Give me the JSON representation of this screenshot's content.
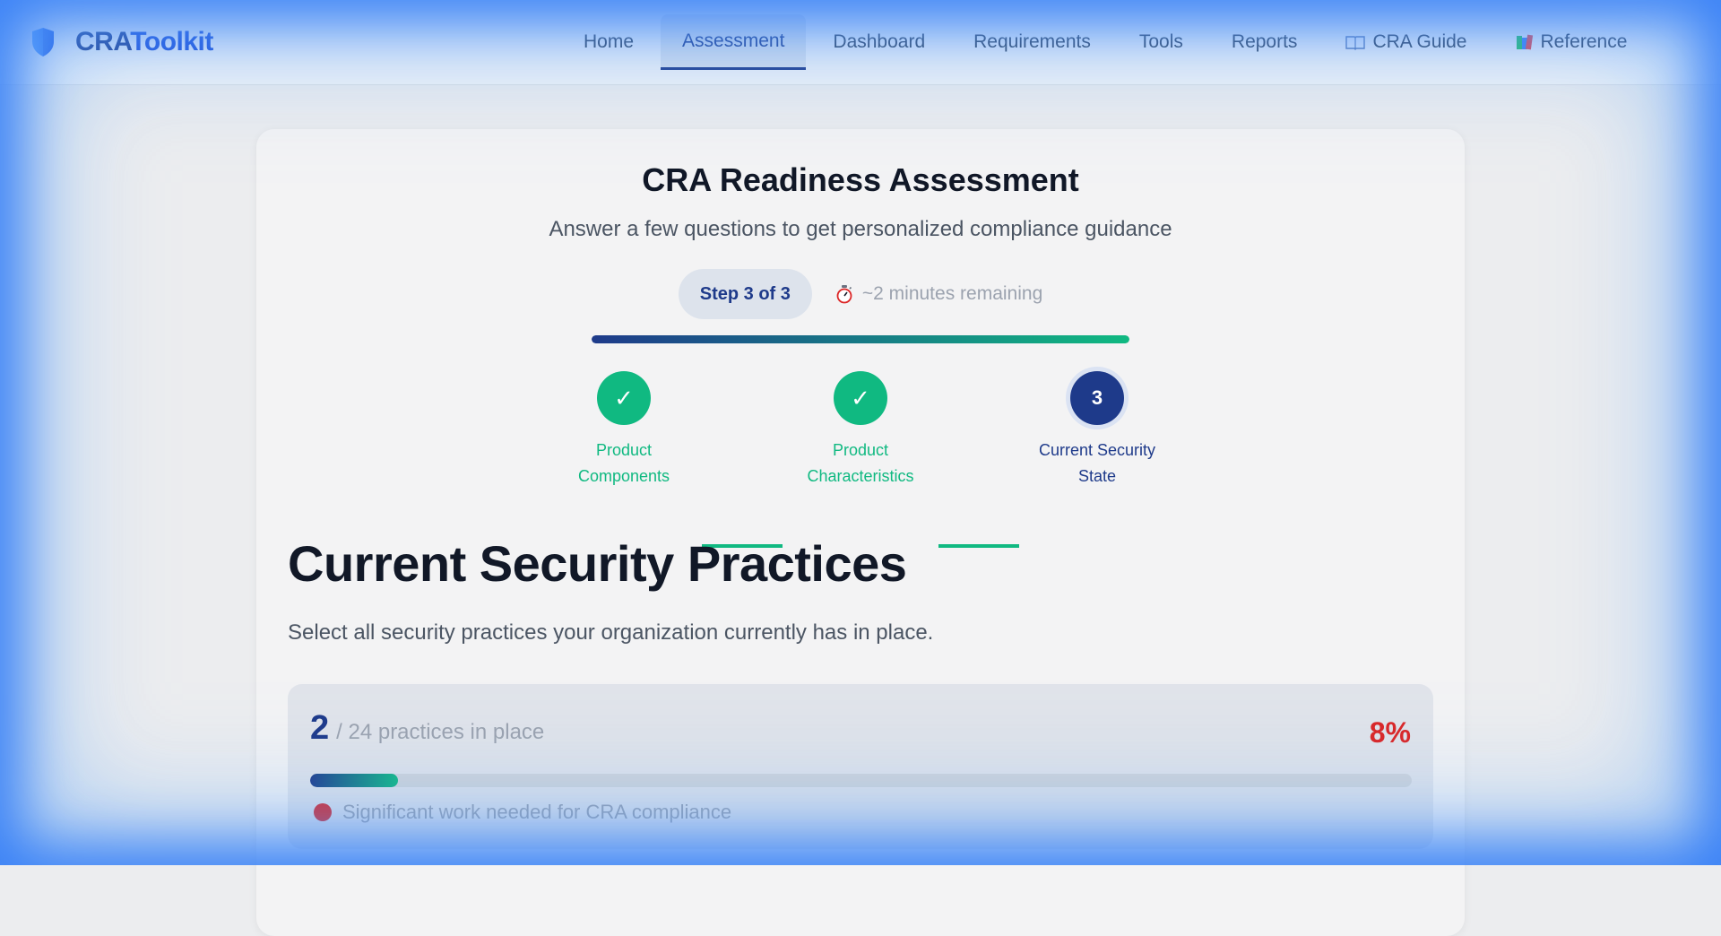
{
  "brand": {
    "name_part1": "CRA",
    "name_part2": "Toolkit"
  },
  "nav": {
    "items": [
      {
        "label": "Home"
      },
      {
        "label": "Assessment",
        "active": true
      },
      {
        "label": "Dashboard"
      },
      {
        "label": "Requirements"
      },
      {
        "label": "Tools"
      },
      {
        "label": "Reports"
      },
      {
        "label": "CRA Guide",
        "icon": "book-icon"
      },
      {
        "label": "Reference",
        "icon": "books-icon"
      }
    ]
  },
  "assessment": {
    "title": "CRA Readiness Assessment",
    "subtitle": "Answer a few questions to get personalized compliance guidance",
    "step_pill": "Step 3 of 3",
    "time_remaining": "~2 minutes remaining",
    "progress_fraction": 1.0,
    "steps": [
      {
        "mark": "✓",
        "label": "Product Components",
        "status": "complete"
      },
      {
        "mark": "✓",
        "label": "Product Characteristics",
        "status": "complete"
      },
      {
        "mark": "3",
        "label": "Current Security State",
        "status": "current"
      }
    ]
  },
  "section": {
    "title": "Current Security Practices",
    "description": "Select all security practices your organization currently has in place."
  },
  "summary": {
    "count": "2",
    "count_text": "/ 24 practices in place",
    "percent": "8%",
    "progress_fraction": 0.08,
    "status_text": "Significant work needed for CRA compliance"
  },
  "colors": {
    "primary": "#1e3a8a",
    "success": "#10b981",
    "danger": "#dc2626",
    "glow": "#3b82f6"
  }
}
